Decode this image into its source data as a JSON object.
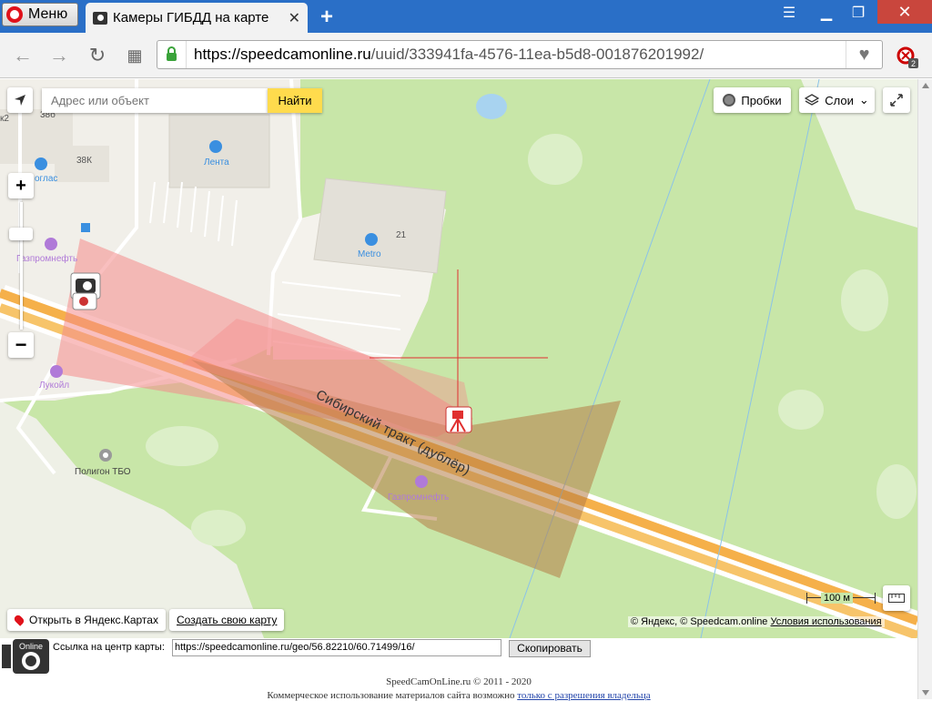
{
  "browser": {
    "menu_label": "Меню",
    "tab_title": "Камеры ГИБДД на карте",
    "tab_close": "✕",
    "new_tab": "+",
    "url_host": "https://speedcamonline.ru",
    "url_path": "/uuid/333941fa-4576-11ea-b5d8-001876201992/",
    "adblock_count": "2"
  },
  "map": {
    "search_placeholder": "Адрес или объект",
    "search_button": "Найти",
    "traffic_button": "Пробки",
    "layers_button": "Слои",
    "zoom_in": "+",
    "zoom_out": "−",
    "scale_label": "100 м",
    "open_yandex": "Открыть в Яндекс.Картах",
    "create_map": "Создать свою карту",
    "copyright": "© Яндекс, © Speedcam.online",
    "terms": "Условия использования",
    "road_label": "Сибирский тракт (дублёр)",
    "labels": {
      "lenta": "Лента",
      "metro": "Metro",
      "gazprom1": "Газпромнефть",
      "gazprom2": "Газпромнефть",
      "lukoil": "Лукойл",
      "poligon": "Полигон ТБО",
      "autoglass": "оглас",
      "b38k": "38К",
      "b21": "21",
      "b38b": "38б",
      "b2": "к2"
    }
  },
  "bottom": {
    "link_label": "Ссылка на центр карты:",
    "link_value": "https://speedcamonline.ru/geo/56.82210/60.71499/16/",
    "copy_button": "Скопировать",
    "footer_line1": "SpeedCamOnLine.ru © 2011 - 2020",
    "footer_line2_prefix": "Коммерческое использование материалов сайта возможно",
    "footer_line2_link": "только с разрешения владельца"
  },
  "colors": {
    "accent_blue": "#2a6fc7",
    "map_green": "#c8e6a8",
    "zone_pink": "#f7a3a3",
    "zone_brown": "#c99a6a",
    "road_orange": "#f5b04a",
    "search_yellow": "#ffdb4d"
  }
}
